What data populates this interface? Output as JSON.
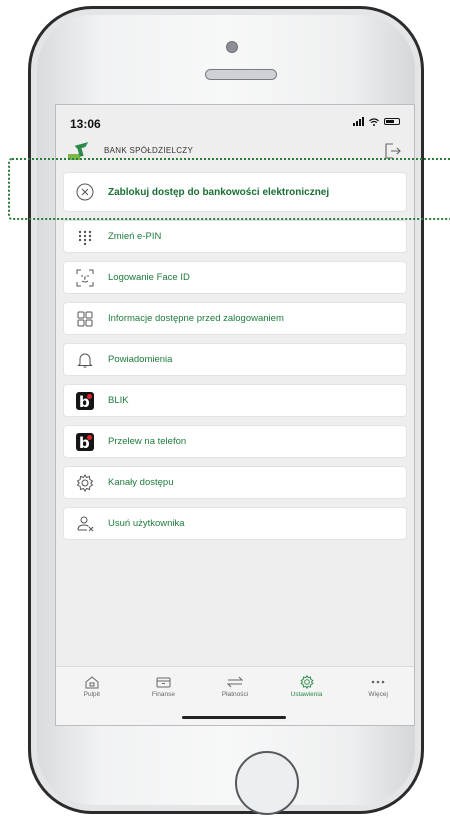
{
  "status_bar": {
    "time": "13:06"
  },
  "header": {
    "bank_name": "BANK SPÓŁDZIELCZY"
  },
  "menu": {
    "items": [
      {
        "label": "Zablokuj dostęp do bankowości elektronicznej",
        "icon": "close-circle-icon"
      },
      {
        "label": "Zmień e-PIN",
        "icon": "keypad-icon"
      },
      {
        "label": "Logowanie Face ID",
        "icon": "face-id-icon"
      },
      {
        "label": "Informacje dostępne przed zalogowaniem",
        "icon": "grid-icon"
      },
      {
        "label": "Powiadomienia",
        "icon": "bell-icon"
      },
      {
        "label": "BLIK",
        "icon": "blik-icon"
      },
      {
        "label": "Przelew na telefon",
        "icon": "blik-icon"
      },
      {
        "label": "Kanały dostępu",
        "icon": "gear-icon"
      },
      {
        "label": "Usuń użytkownika",
        "icon": "user-remove-icon"
      }
    ]
  },
  "tabs": [
    {
      "label": "Pulpit",
      "icon": "home-icon"
    },
    {
      "label": "Finanse",
      "icon": "wallet-icon"
    },
    {
      "label": "Płatności",
      "icon": "transfer-icon"
    },
    {
      "label": "Ustawienia",
      "icon": "gear-icon",
      "active": true
    },
    {
      "label": "Więcej",
      "icon": "more-icon"
    }
  ],
  "colors": {
    "accent": "#2b8a4a",
    "menu_text": "#1e7b3c",
    "highlight_border": "#2d7d3a"
  }
}
